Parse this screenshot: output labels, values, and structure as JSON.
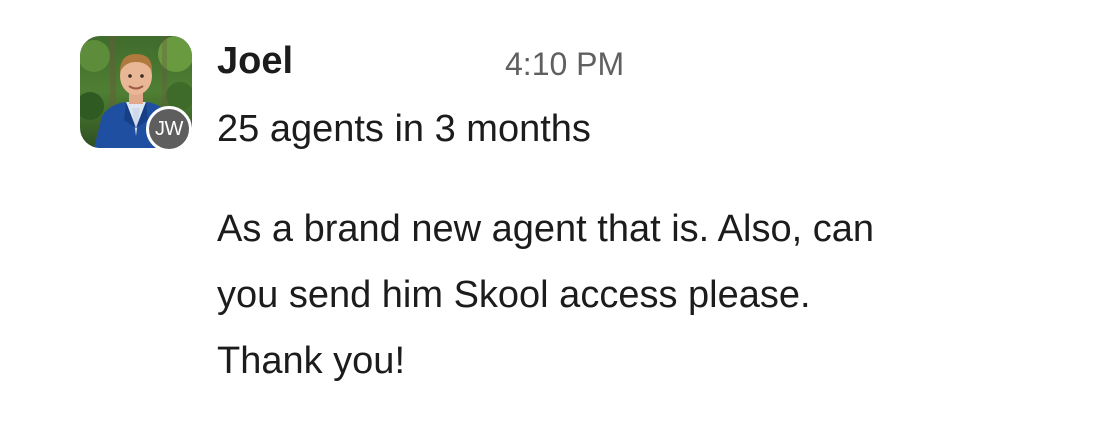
{
  "message": {
    "sender": "Joel",
    "timestamp": "4:10 PM",
    "avatar_initials": "JW",
    "subject": "25 agents in 3 months",
    "body_lines": [
      "As a brand new agent that is. Also, can",
      "you send him Skool access please.",
      "Thank you!"
    ]
  },
  "colors": {
    "text": "#1d1c1d",
    "timestamp": "#616061",
    "badge_bg": "#5e5e5e"
  },
  "icons": {
    "avatar": "profile-photo",
    "badge": "initials-badge"
  }
}
